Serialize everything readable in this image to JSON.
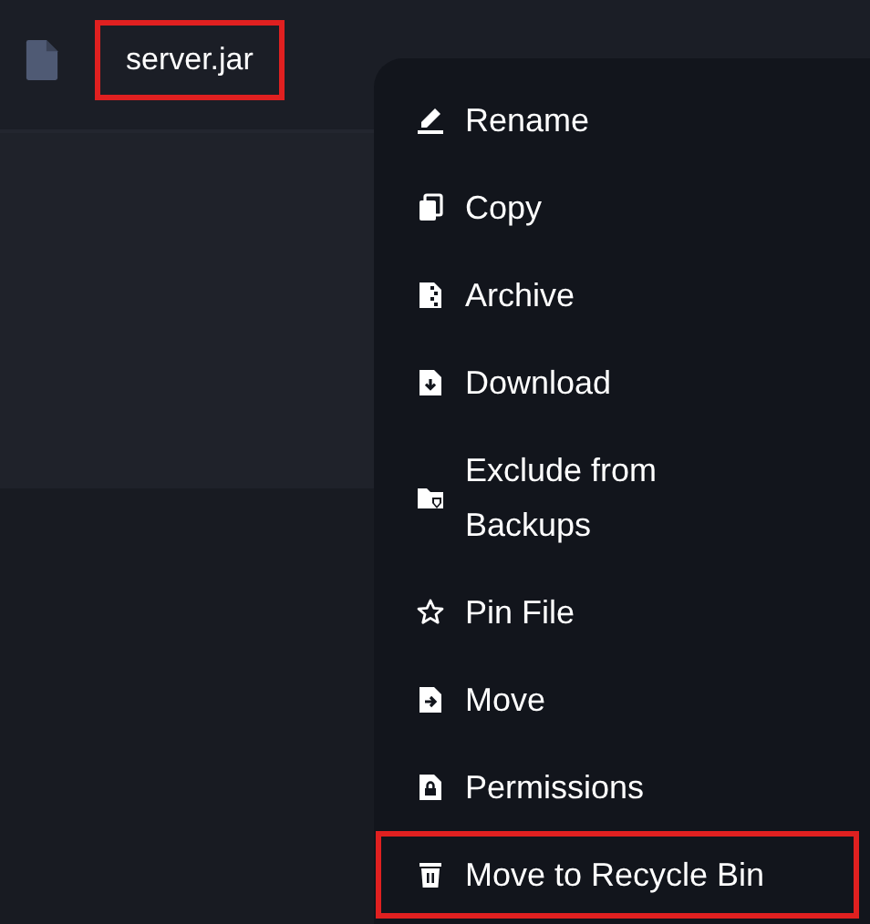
{
  "file": {
    "name": "server.jar",
    "highlighted": true
  },
  "context_menu": {
    "items": [
      {
        "kind": "rename",
        "label": "Rename",
        "highlighted": false,
        "wrapped": false
      },
      {
        "kind": "copy",
        "label": "Copy",
        "highlighted": false,
        "wrapped": false
      },
      {
        "kind": "archive",
        "label": "Archive",
        "highlighted": false,
        "wrapped": false
      },
      {
        "kind": "download",
        "label": "Download",
        "highlighted": false,
        "wrapped": false
      },
      {
        "kind": "exclude",
        "label": "Exclude from Backups",
        "highlighted": false,
        "wrapped": true
      },
      {
        "kind": "pin",
        "label": "Pin File",
        "highlighted": false,
        "wrapped": false
      },
      {
        "kind": "move",
        "label": "Move",
        "highlighted": false,
        "wrapped": false
      },
      {
        "kind": "permissions",
        "label": "Permissions",
        "highlighted": false,
        "wrapped": false
      },
      {
        "kind": "delete",
        "label": "Move to Recycle Bin",
        "highlighted": true,
        "wrapped": false
      }
    ]
  }
}
